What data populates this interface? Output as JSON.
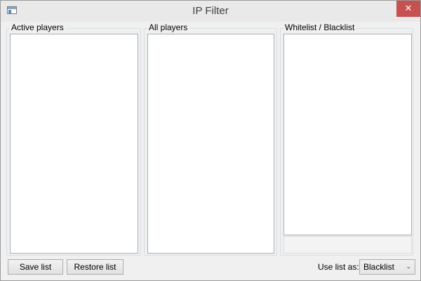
{
  "window": {
    "title": "IP Filter",
    "close_glyph": "✕"
  },
  "groups": {
    "active_players": "Active players",
    "all_players": "All players",
    "list": "Whitelist / Blacklist"
  },
  "buttons": {
    "save": "Save list",
    "restore": "Restore list"
  },
  "use_list": {
    "label": "Use list as:",
    "selected": "Blacklist"
  },
  "icons": {
    "app": "window-app-icon",
    "close": "close-icon",
    "dropdown": "chevron-down-icon"
  },
  "colors": {
    "close_button": "#c75050",
    "window_bg": "#f0f0f0",
    "list_bg": "#ffffff"
  }
}
